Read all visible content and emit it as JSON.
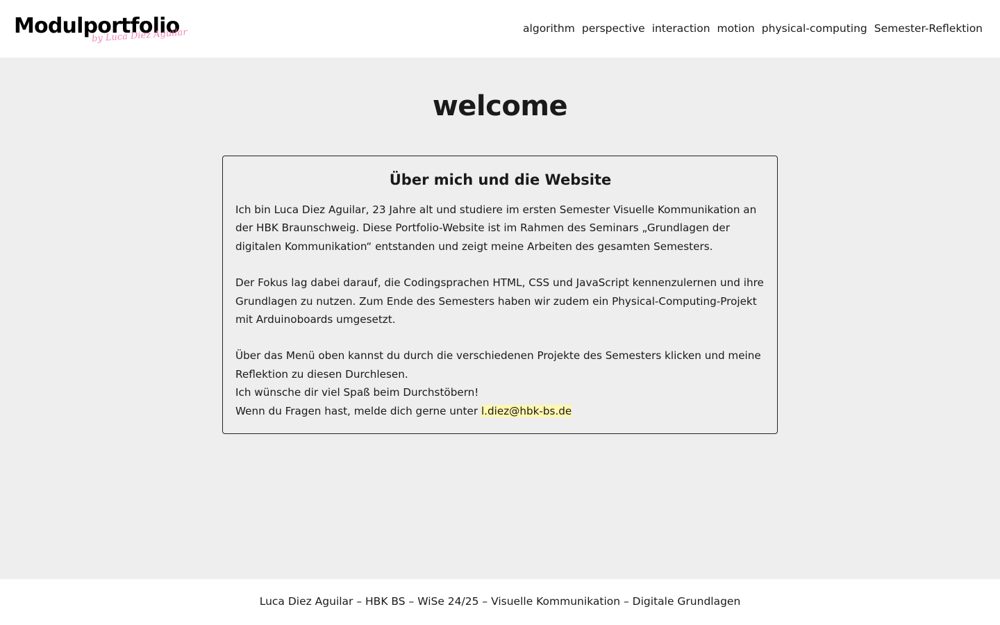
{
  "header": {
    "logo_title": "Modulportfolio",
    "logo_script": "by Luca Diez Aguilar",
    "nav": [
      {
        "label": "algorithm"
      },
      {
        "label": "perspective"
      },
      {
        "label": "interaction"
      },
      {
        "label": "motion"
      },
      {
        "label": "physical-computing"
      },
      {
        "label": "Semester-Reflektion"
      }
    ]
  },
  "main": {
    "heading": "welcome",
    "card": {
      "title": "Über mich und die Website",
      "paragraph1": "Ich bin Luca Diez Aguilar, 23 Jahre alt und studiere im ersten Semester Visuelle Kommunikation an der HBK Braunschweig. Diese Portfolio-Website ist im Rahmen des Seminars „Grundlagen der digitalen Kommunikation“ entstanden und zeigt meine Arbeiten des gesamten Semesters.",
      "paragraph2": "Der Fokus lag dabei darauf, die Codingsprachen HTML, CSS und JavaScript kennenzulernen und ihre Grundlagen zu nutzen. Zum Ende des Semesters haben wir zudem ein Physical-Computing-Projekt mit Arduinoboards umgesetzt.",
      "paragraph3": "Über das Menü oben kannst du durch die verschiedenen Projekte des Semesters klicken und meine Reflektion zu diesen Durchlesen.",
      "line_enjoy": "Ich wünsche dir viel Spaß beim Durchstöbern!",
      "line_contact_prefix": "Wenn du Fragen hast, melde dich gerne unter ",
      "email": "l.diez@hbk-bs.de",
      "email_highlight_color": "#fff6b0"
    }
  },
  "footer": {
    "text": "Luca Diez Aguilar – HBK BS – WiSe 24/25 – Visuelle Kommunikation – Digitale Grundlagen"
  }
}
